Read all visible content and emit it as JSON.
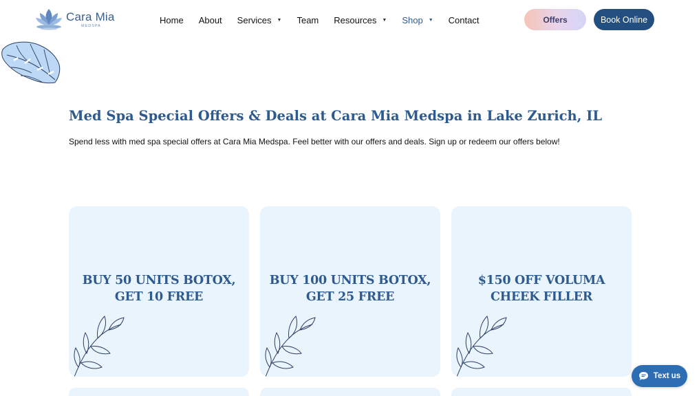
{
  "brand": {
    "name": "Cara Mia",
    "subtitle": "MEDSPA",
    "colors": {
      "primary": "#2e5a8e",
      "dark": "#234e80",
      "card_bg": "#eaf4fd",
      "chat": "#2c6db3"
    }
  },
  "nav": {
    "items": [
      {
        "label": "Home",
        "has_dropdown": false
      },
      {
        "label": "About",
        "has_dropdown": false
      },
      {
        "label": "Services",
        "has_dropdown": true
      },
      {
        "label": "Team",
        "has_dropdown": false
      },
      {
        "label": "Resources",
        "has_dropdown": true
      },
      {
        "label": "Shop",
        "has_dropdown": true,
        "active": true
      },
      {
        "label": "Contact",
        "has_dropdown": false
      }
    ],
    "offers_label": "Offers",
    "book_label": "Book Online"
  },
  "page": {
    "title": "Med Spa Special Offers & Deals at Cara Mia Medspa in Lake Zurich, IL",
    "intro": "Spend less with med spa special offers at Cara Mia Medspa. Feel better with our offers and deals. Sign up or redeem our offers below!"
  },
  "offers": [
    {
      "line1": "BUY 50 UNITS BOTOX,",
      "line2": "GET 10 FREE"
    },
    {
      "line1": "BUY 100 UNITS BOTOX,",
      "line2": "GET 25 FREE"
    },
    {
      "line1": "$150 OFF VOLUMA",
      "line2": "CHEEK FILLER"
    }
  ],
  "chat": {
    "label": "Text us",
    "icon": "chat-bubble-icon"
  },
  "icons": {
    "logo": "lotus-icon",
    "decoration": "monstera-leaf-icon",
    "card_decoration": "branch-leaf-icon",
    "dropdown": "caret-down-icon"
  }
}
